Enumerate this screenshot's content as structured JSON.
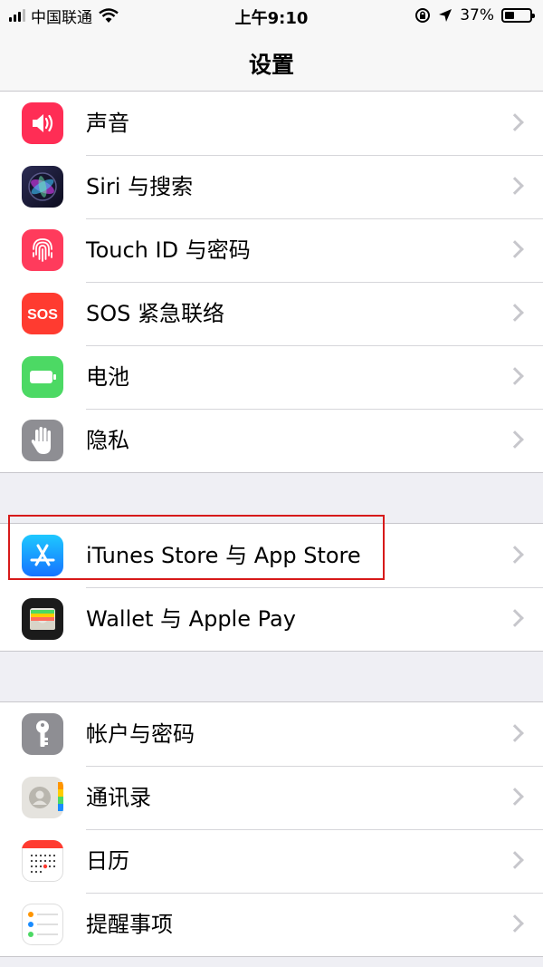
{
  "status_bar": {
    "carrier": "中国联通",
    "time": "上午9:10",
    "battery_percent": "37%",
    "battery_level": 0.37
  },
  "nav": {
    "title": "设置"
  },
  "groups": [
    {
      "items": [
        {
          "label": "声音",
          "icon": "speaker-icon",
          "color": "#ff2d55"
        },
        {
          "label": "Siri 与搜索",
          "icon": "siri-icon",
          "color": "#1c1c3a"
        },
        {
          "label": "Touch ID 与密码",
          "icon": "fingerprint-icon",
          "color": "#ff3b5c"
        },
        {
          "label": "SOS 紧急联络",
          "icon": "sos-icon",
          "color": "#ff3b30"
        },
        {
          "label": "电池",
          "icon": "battery-icon",
          "color": "#4cd964"
        },
        {
          "label": "隐私",
          "icon": "hand-icon",
          "color": "#8e8e93"
        }
      ]
    },
    {
      "items": [
        {
          "label": "iTunes Store 与 App Store",
          "icon": "app-store-icon",
          "color": "#1a8cff"
        },
        {
          "label": "Wallet 与 Apple Pay",
          "icon": "wallet-icon",
          "color": "#1b1b1b"
        }
      ]
    },
    {
      "items": [
        {
          "label": "帐户与密码",
          "icon": "key-icon",
          "color": "#8e8e93"
        },
        {
          "label": "通讯录",
          "icon": "contacts-icon",
          "color": "#e5e3de"
        },
        {
          "label": "日历",
          "icon": "calendar-icon",
          "color": "#ffffff"
        },
        {
          "label": "提醒事项",
          "icon": "reminders-icon",
          "color": "#ffffff"
        }
      ]
    }
  ]
}
